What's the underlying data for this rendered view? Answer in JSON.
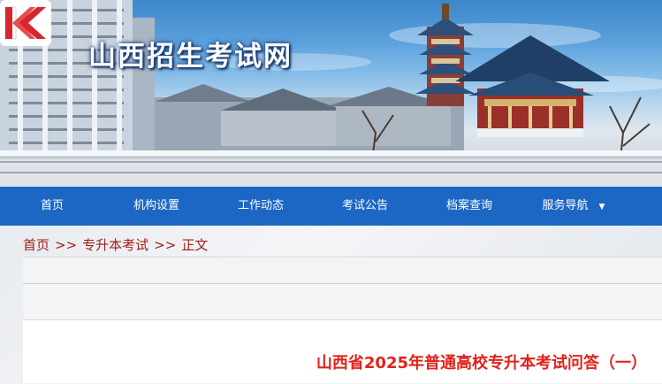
{
  "site": {
    "title": "山西招生考试网"
  },
  "nav": {
    "items": [
      {
        "label": "首页"
      },
      {
        "label": "机构设置"
      },
      {
        "label": "工作动态"
      },
      {
        "label": "考试公告"
      },
      {
        "label": "档案查询"
      },
      {
        "label": "服务导航",
        "caret": "▼"
      }
    ]
  },
  "breadcrumb": {
    "home": "首页",
    "sep1": ">>",
    "section": "专升本考试",
    "sep2": ">>",
    "current": "正文"
  },
  "article": {
    "title": "山西省2025年普通高校专升本考试问答（一）"
  },
  "colors": {
    "nav_bg": "#1c67c4",
    "breadcrumb": "#a12018",
    "article_title": "#e0231c",
    "logo_red": "#d8262c"
  }
}
